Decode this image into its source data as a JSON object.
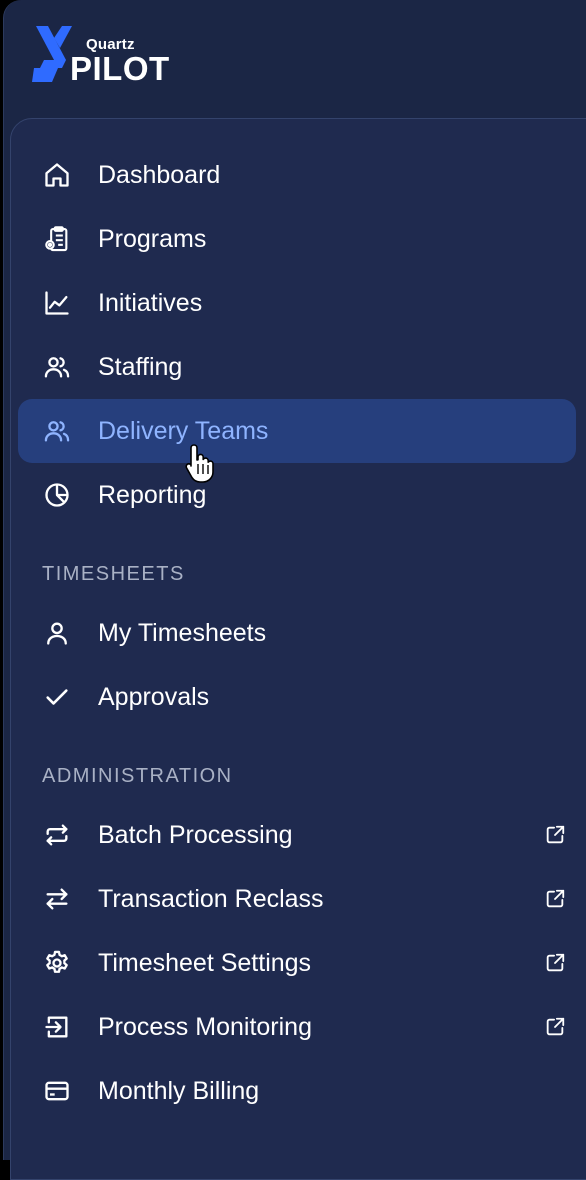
{
  "app": {
    "brand_small": "Quartz",
    "brand_large": "PILOT"
  },
  "nav": {
    "main": [
      {
        "label": "Dashboard",
        "icon": "home-icon"
      },
      {
        "label": "Programs",
        "icon": "clipboard-gear-icon"
      },
      {
        "label": "Initiatives",
        "icon": "line-chart-icon"
      },
      {
        "label": "Staffing",
        "icon": "users-icon"
      },
      {
        "label": "Delivery Teams",
        "icon": "users-icon",
        "active": true
      },
      {
        "label": "Reporting",
        "icon": "pie-chart-icon"
      }
    ],
    "timesheets_heading": "TIMESHEETS",
    "timesheets": [
      {
        "label": "My Timesheets",
        "icon": "user-icon"
      },
      {
        "label": "Approvals",
        "icon": "check-icon"
      }
    ],
    "administration_heading": "ADMINISTRATION",
    "administration": [
      {
        "label": "Batch Processing",
        "icon": "repeat-icon",
        "external": true
      },
      {
        "label": "Transaction Reclass",
        "icon": "swap-arrows-icon",
        "external": true
      },
      {
        "label": "Timesheet Settings",
        "icon": "gear-icon",
        "external": true
      },
      {
        "label": "Process Monitoring",
        "icon": "sign-in-icon",
        "external": true
      },
      {
        "label": "Monthly Billing",
        "icon": "credit-card-icon",
        "external": false
      }
    ]
  },
  "colors": {
    "sidebar_bg": "#1b2645",
    "panel_bg": "#1f2a4f",
    "active_bg": "#263f7d",
    "active_text": "#8fb4ff",
    "logo_blue": "#2f6bff"
  }
}
